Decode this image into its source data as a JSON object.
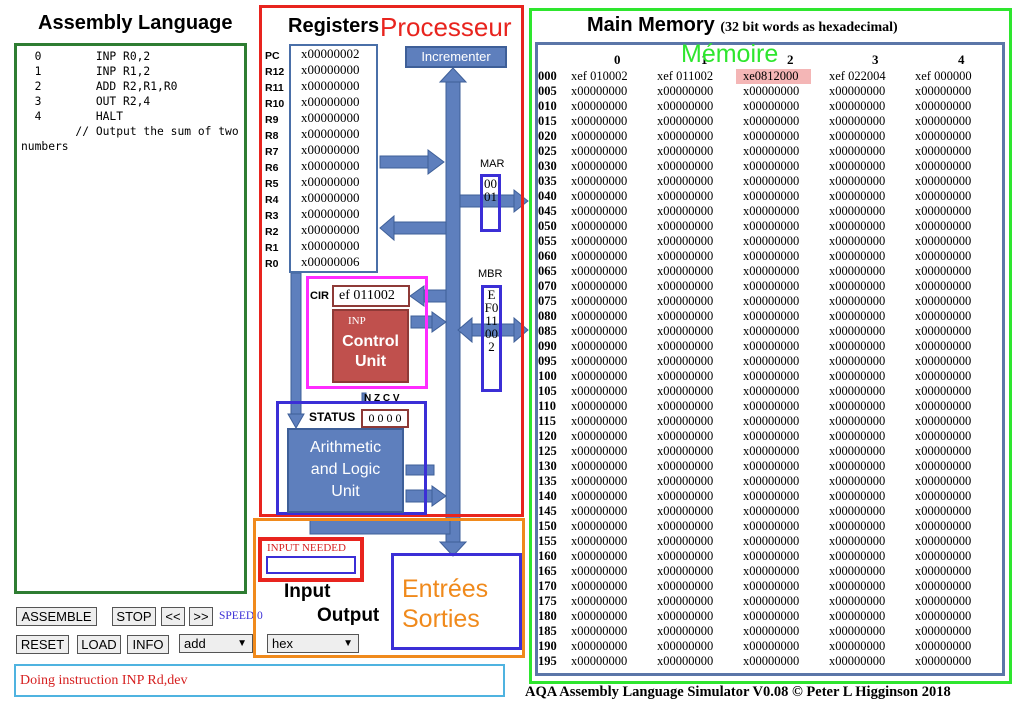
{
  "left_panel": {
    "title": "Assembly Language",
    "code": "  0        INP R0,2\n  1        INP R1,2\n  2        ADD R2,R1,R0\n  3        OUT R2,4\n  4        HALT\n        // Output the sum of two numbers",
    "buttons": {
      "assemble": "ASSEMBLE",
      "stop": "STOP",
      "back": "<<",
      "forward": ">>",
      "reset": "RESET",
      "load": "LOAD",
      "info": "INFO"
    },
    "speed_label": "SPEED 0",
    "example_select": "add",
    "format_select": "hex",
    "status_message": "Doing instruction INP Rd,dev"
  },
  "processor": {
    "registers_title": "Registers",
    "overlay_label": "Processeur",
    "registers": [
      {
        "name": "PC",
        "value": "x00000002"
      },
      {
        "name": "R12",
        "value": "x00000000"
      },
      {
        "name": "R11",
        "value": "x00000000"
      },
      {
        "name": "R10",
        "value": "x00000000"
      },
      {
        "name": "R9",
        "value": "x00000000"
      },
      {
        "name": "R8",
        "value": "x00000000"
      },
      {
        "name": "R7",
        "value": "x00000000"
      },
      {
        "name": "R6",
        "value": "x00000000"
      },
      {
        "name": "R5",
        "value": "x00000000"
      },
      {
        "name": "R4",
        "value": "x00000000"
      },
      {
        "name": "R3",
        "value": "x00000000"
      },
      {
        "name": "R2",
        "value": "x00000000"
      },
      {
        "name": "R1",
        "value": "x00000000"
      },
      {
        "name": "R0",
        "value": "x00000006"
      }
    ],
    "incrementer": "Incrementer",
    "mar_label": "MAR",
    "mar_value": "0001",
    "mbr_label": "MBR",
    "mbr_value": "EF011002",
    "cir_label": "CIR",
    "cir_value": "ef 011002",
    "cu_instruction": "INP",
    "cu_title_1": "Control",
    "cu_title_2": "Unit",
    "flags_label": "N Z C V",
    "status_label": "STATUS",
    "status_value": "0 0 0 0",
    "alu_1": "Arithmetic",
    "alu_2": "and Logic",
    "alu_3": "Unit"
  },
  "io": {
    "input_needed": "INPUT NEEDED",
    "input_label": "Input",
    "output_label": "Output",
    "overlay_1": "Entrées",
    "overlay_2": "Sorties"
  },
  "memory": {
    "title": "Main Memory",
    "subtitle": "(32 bit words as hexadecimal)",
    "overlay_label": "Mémoire",
    "columns": [
      "0",
      "1",
      "2",
      "3",
      "4"
    ],
    "first_row": [
      "xef 010002",
      "xef 011002",
      "xe0812000",
      "xef 022004",
      "xef 000000"
    ],
    "highlight_address": "xe0812000",
    "default_value": "x00000000",
    "row_addresses": [
      "000",
      "005",
      "010",
      "015",
      "020",
      "025",
      "030",
      "035",
      "040",
      "045",
      "050",
      "055",
      "060",
      "065",
      "070",
      "075",
      "080",
      "085",
      "090",
      "095",
      "100",
      "105",
      "110",
      "115",
      "120",
      "125",
      "130",
      "135",
      "140",
      "145",
      "150",
      "155",
      "160",
      "165",
      "170",
      "175",
      "180",
      "185",
      "190",
      "195"
    ]
  },
  "footer": "AQA Assembly Language Simulator V0.08  © Peter L Higginson 2018",
  "colors": {
    "processor": "#e8241e",
    "memory": "#2ee62e",
    "io": "#f08a1c",
    "alu": "#5e7fbd",
    "cu": "#c0504d",
    "bus": "#5e7fbd",
    "cu_box": "#ff2bff",
    "status_msg": "#d62020"
  }
}
